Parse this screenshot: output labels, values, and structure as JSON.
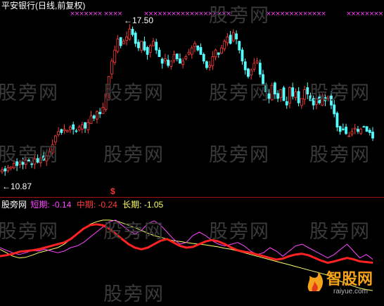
{
  "header": {
    "title": "平安银行(日线,前复权)"
  },
  "watermark": "股旁网",
  "logo": {
    "text": "智股网",
    "url": "raiyue.com",
    "color": "#f5a21b"
  },
  "colors": {
    "up": "#ff3b3b",
    "down": "#54ffff",
    "short": "#ff44ff",
    "mid": "#ff2222",
    "long": "#ffff66",
    "divider": "#a01010",
    "marker": "#ff44ff"
  },
  "chart_data": [
    {
      "type": "candlestick",
      "title": "平安银行(日线,前复权)",
      "annotations": [
        {
          "text": "17.50",
          "kind": "high",
          "arrow": "←"
        },
        {
          "text": "10.87",
          "kind": "low",
          "arrow": "←"
        },
        {
          "text": "$",
          "kind": "signal"
        }
      ],
      "ylim": [
        10.4,
        18.2
      ],
      "close": [
        11.05,
        11.0,
        11.15,
        11.2,
        11.35,
        11.25,
        11.4,
        11.3,
        11.5,
        11.45,
        11.3,
        11.55,
        11.4,
        11.6,
        11.5,
        11.7,
        11.9,
        12.2,
        12.6,
        12.8,
        12.75,
        12.9,
        12.85,
        13.0,
        12.9,
        12.8,
        13.0,
        13.1,
        12.95,
        13.2,
        13.5,
        13.4,
        13.7,
        13.6,
        13.9,
        14.5,
        15.3,
        16.0,
        16.5,
        17.0,
        16.7,
        16.9,
        17.1,
        17.45,
        17.2,
        16.8,
        16.6,
        16.9,
        16.5,
        16.3,
        16.7,
        16.9,
        16.5,
        16.2,
        15.9,
        16.1,
        15.8,
        16.0,
        16.3,
        16.1,
        15.9,
        16.0,
        16.2,
        16.4,
        16.6,
        16.8,
        16.5,
        16.3,
        16.0,
        15.7,
        15.8,
        16.2,
        16.5,
        16.3,
        16.6,
        16.9,
        17.1,
        16.8,
        17.3,
        17.0,
        16.5,
        16.0,
        15.6,
        15.3,
        15.6,
        15.9,
        16.0,
        15.4,
        14.9,
        14.6,
        14.3,
        14.9,
        14.5,
        14.3,
        14.7,
        14.2,
        14.0,
        14.8,
        14.4,
        14.6,
        14.1,
        14.3,
        14.7,
        14.5,
        14.2,
        14.0,
        14.3,
        14.1,
        14.3,
        14.2,
        14.4,
        14.0,
        13.6,
        13.0,
        12.8,
        12.9,
        12.7,
        12.6,
        12.8,
        12.95,
        12.8,
        12.9,
        13.0,
        12.8,
        12.75,
        12.5
      ],
      "series": [
        {
          "name": "短期",
          "label": "短期:",
          "value": "-0.14"
        },
        {
          "name": "中期",
          "label": "中期:",
          "value": "-0.24"
        },
        {
          "name": "长期",
          "label": "长期:",
          "value": "-1.05"
        }
      ]
    },
    {
      "type": "line",
      "title": "股旁网",
      "series_values": {
        "short": [
          0.2,
          0.12,
          0.05,
          0.0,
          0.05,
          0.12,
          0.1,
          0.15,
          0.1,
          0.05,
          0.1,
          0.2,
          0.25,
          0.35,
          0.5,
          0.65,
          0.8,
          0.95,
          1.0,
          0.85,
          0.7,
          0.6,
          0.7,
          0.9,
          0.98,
          0.85,
          0.65,
          0.45,
          0.3,
          0.35,
          0.55,
          0.65,
          0.55,
          0.4,
          0.3,
          0.25,
          0.3,
          0.35,
          0.25,
          0.1,
          0.0,
          0.05,
          0.2,
          0.1,
          -0.05,
          0.1,
          0.25,
          0.3,
          0.2,
          0.1,
          0.0,
          -0.1,
          0.0,
          0.15,
          0.3,
          0.1,
          -0.1,
          0.0,
          -0.14
        ],
        "mid": [
          -0.05,
          -0.02,
          0.02,
          0.08,
          0.1,
          0.12,
          0.15,
          0.2,
          0.25,
          0.3,
          0.35,
          0.45,
          0.6,
          0.75,
          0.85,
          0.88,
          0.85,
          0.75,
          0.6,
          0.45,
          0.3,
          0.2,
          0.15,
          0.2,
          0.3,
          0.4,
          0.45,
          0.35,
          0.25,
          0.2,
          0.22,
          0.3,
          0.38,
          0.42,
          0.38,
          0.3,
          0.2,
          0.12,
          0.08,
          0.05,
          0.0,
          -0.05,
          -0.1,
          -0.15,
          -0.12,
          -0.05,
          0.0,
          0.02,
          -0.02,
          -0.1,
          -0.18,
          -0.24,
          -0.2,
          -0.15,
          -0.1,
          -0.14,
          -0.2,
          -0.22,
          -0.24
        ],
        "long": [
          0.15,
          0.05,
          -0.05,
          -0.1,
          -0.08,
          -0.02,
          0.05,
          0.1,
          0.15,
          0.2,
          0.3,
          0.45,
          0.6,
          0.75,
          0.88,
          0.95,
          1.0,
          1.0,
          0.98,
          0.92,
          0.85,
          0.78,
          0.7,
          0.62,
          0.55,
          0.5,
          0.45,
          0.4,
          0.38,
          0.35,
          0.32,
          0.3,
          0.28,
          0.25,
          0.22,
          0.18,
          0.15,
          0.1,
          0.05,
          0.0,
          -0.05,
          -0.1,
          -0.15,
          -0.2,
          -0.25,
          -0.3,
          -0.35,
          -0.4,
          -0.45,
          -0.5,
          -0.55,
          -0.6,
          -0.7,
          -0.78,
          -0.85,
          -0.92,
          -0.98,
          -1.02,
          -1.05
        ]
      }
    }
  ]
}
